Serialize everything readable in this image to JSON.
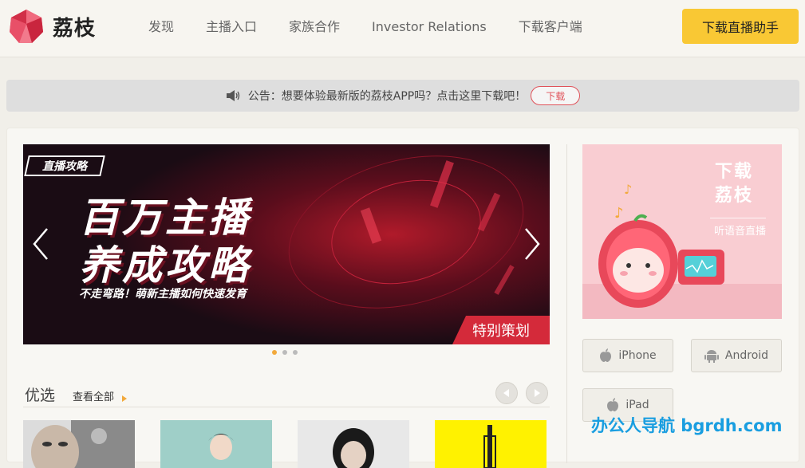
{
  "brand": {
    "name": "荔枝"
  },
  "nav": {
    "items": [
      "发现",
      "主播入口",
      "家族合作",
      "Investor Relations",
      "下载客户端"
    ],
    "cta": "下载直播助手"
  },
  "notice": {
    "text": "公告：想要体验最新版的荔枝APP吗？点击这里下载吧！",
    "button": "下载"
  },
  "banner": {
    "tag": "直播攻略",
    "title_line1": "百万主播",
    "title_line2": "养成攻略",
    "subtitle": "不走弯路！萌新主播如何快速发育",
    "corner": "特别策划",
    "dots": 3,
    "active_dot": 0
  },
  "section": {
    "title": "优选",
    "more": "查看全部"
  },
  "sidebar": {
    "promo_title_line1": "下载",
    "promo_title_line2": "荔枝",
    "promo_sub": "听语音直播",
    "downloads": [
      "iPhone",
      "Android",
      "iPad"
    ]
  },
  "watermark": "办公人导航 bgrdh.com",
  "colors": {
    "accent": "#f9c834",
    "brand_red": "#e0525a",
    "banner_red": "#d42a3a",
    "watermark": "#1a9ee0"
  }
}
